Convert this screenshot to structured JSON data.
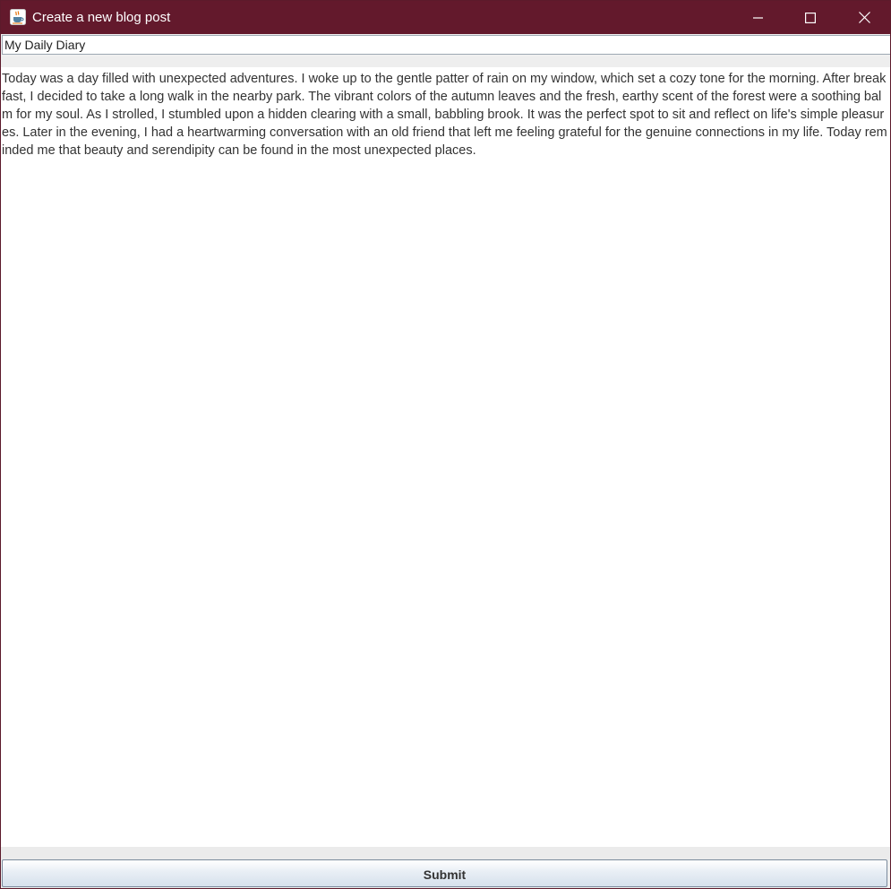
{
  "window": {
    "title": "Create a new blog post",
    "app_icon": "java-coffee-cup-icon",
    "controls": {
      "minimize_icon": "minimize-icon",
      "maximize_icon": "maximize-icon",
      "close_icon": "close-icon"
    },
    "titlebar_color": "#63192c"
  },
  "form": {
    "post_title_value": "My Daily Diary",
    "post_body_value": "Today was a day filled with unexpected adventures. I woke up to the gentle patter of rain on my window, which set a cozy tone for the morning. After breakfast, I decided to take a long walk in the nearby park. The vibrant colors of the autumn leaves and the fresh, earthy scent of the forest were a soothing balm for my soul. As I strolled, I stumbled upon a hidden clearing with a small, babbling brook. It was the perfect spot to sit and reflect on life's simple pleasures. Later in the evening, I had a heartwarming conversation with an old friend that left me feeling grateful for the genuine connections in my life. Today reminded me that beauty and serendipity can be found in the most unexpected places.",
    "submit_label": "Submit"
  }
}
